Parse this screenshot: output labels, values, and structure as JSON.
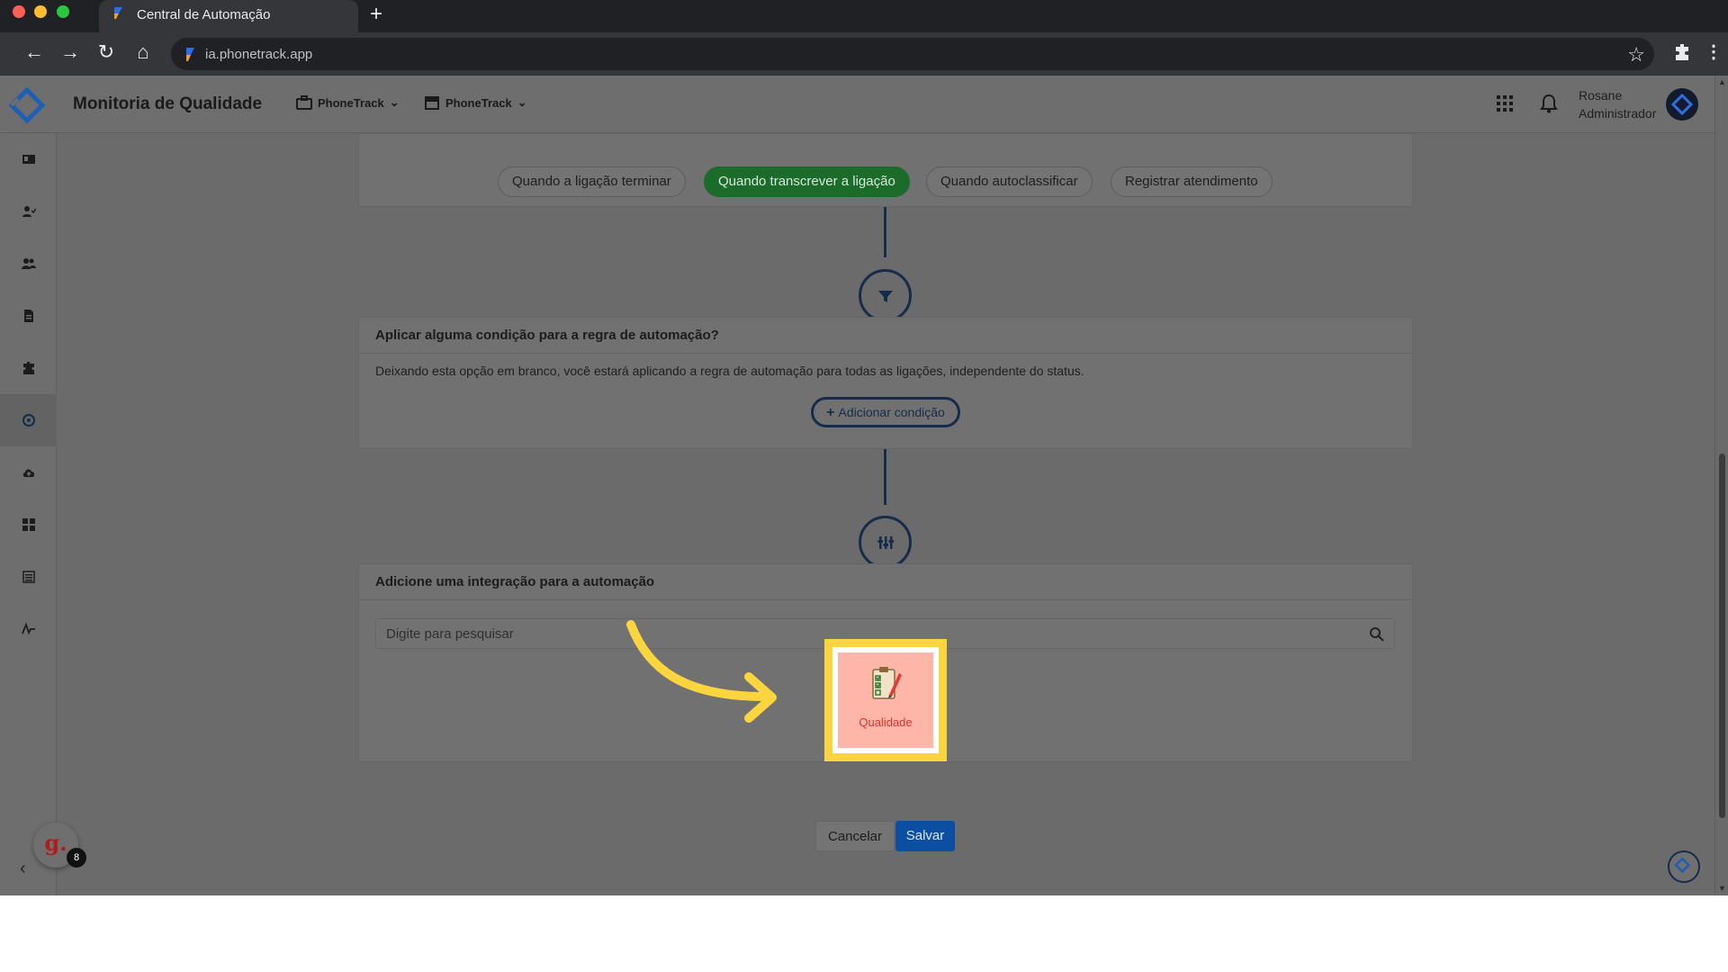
{
  "browser": {
    "tab_title": "Central de Automação",
    "new_tab": "+",
    "url": "ia.phonetrack.app"
  },
  "header": {
    "title": "Monitoria de Qualidade",
    "company_1": "PhoneTrack",
    "company_2": "PhoneTrack",
    "user_name": "Rosane",
    "user_role": "Administrador"
  },
  "sidebar": {
    "items": [
      "id-card-icon",
      "user-check-icon",
      "users-icon",
      "document-icon",
      "puzzle-icon",
      "automation-icon",
      "cloud-upload-icon",
      "apps-icon",
      "list-icon",
      "signature-icon"
    ],
    "active_index": 5,
    "badge_letter": "g.",
    "badge_count": "8"
  },
  "triggers": {
    "tabs": [
      {
        "label": "Quando a ligação terminar",
        "active": false
      },
      {
        "label": "Quando transcrever a ligação",
        "active": true
      },
      {
        "label": "Quando autoclassificar",
        "active": false
      },
      {
        "label": "Registrar atendimento",
        "active": false
      }
    ]
  },
  "condition": {
    "title": "Aplicar alguma condição para a regra de automação?",
    "description": "Deixando esta opção em branco, você estará aplicando a regra de automação para todas as ligações, independente do status.",
    "add_label": "Adicionar condição"
  },
  "integration": {
    "title": "Adicione uma integração para a automação",
    "search_placeholder": "Digite para pesquisar",
    "items": [
      {
        "label": "Qualidade"
      }
    ]
  },
  "actions": {
    "cancel": "Cancelar",
    "save": "Salvar"
  },
  "colors": {
    "accent_green": "#1b6b2b",
    "primary_blue": "#0c4fa2",
    "highlight_yellow": "#fad53f",
    "node_navy": "#162c4a"
  }
}
